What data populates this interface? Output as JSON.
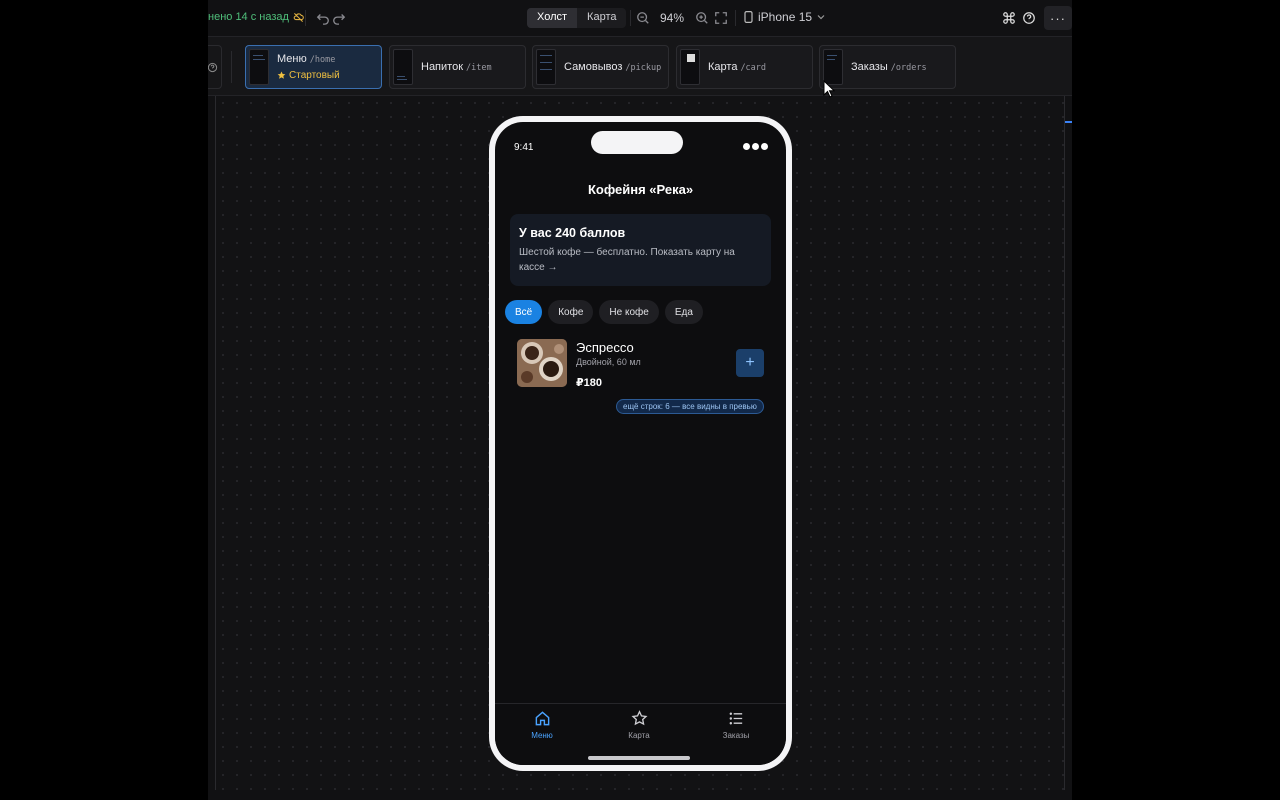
{
  "toolbar": {
    "saved_label": "нено 14 с назад",
    "mode_tabs": [
      "Холст",
      "Карта"
    ],
    "zoom": "94%",
    "device": "iPhone 15"
  },
  "pages": [
    {
      "name": "Меню",
      "route": "/home",
      "start_label": "Стартовый"
    },
    {
      "name": "Напиток",
      "route": "/item"
    },
    {
      "name": "Самовывоз",
      "route": "/pickup"
    },
    {
      "name": "Карта",
      "route": "/card"
    },
    {
      "name": "Заказы",
      "route": "/orders"
    }
  ],
  "phone": {
    "status_time": "9:41",
    "title": "Кофейня «Река»",
    "loyalty": {
      "title": "У вас 240 баллов",
      "text": "Шестой кофе — бесплатно. Показать карту на кассе →"
    },
    "filters": [
      "Всё",
      "Кофе",
      "Не кофе",
      "Еда"
    ],
    "item": {
      "name": "Эспрессо",
      "description": "Двойной, 60 мл",
      "price": "₽180",
      "add_label": "+"
    },
    "more_rows_badge": "ещё строк: 6 — все видны в превью",
    "tabs": [
      {
        "label": "Меню",
        "icon": "home-icon"
      },
      {
        "label": "Карта",
        "icon": "star-icon"
      },
      {
        "label": "Заказы",
        "icon": "list-icon"
      }
    ]
  },
  "colors": {
    "accent": "#1a82e2",
    "start_badge": "#f0c040",
    "saved_status": "#4fbf7a"
  }
}
